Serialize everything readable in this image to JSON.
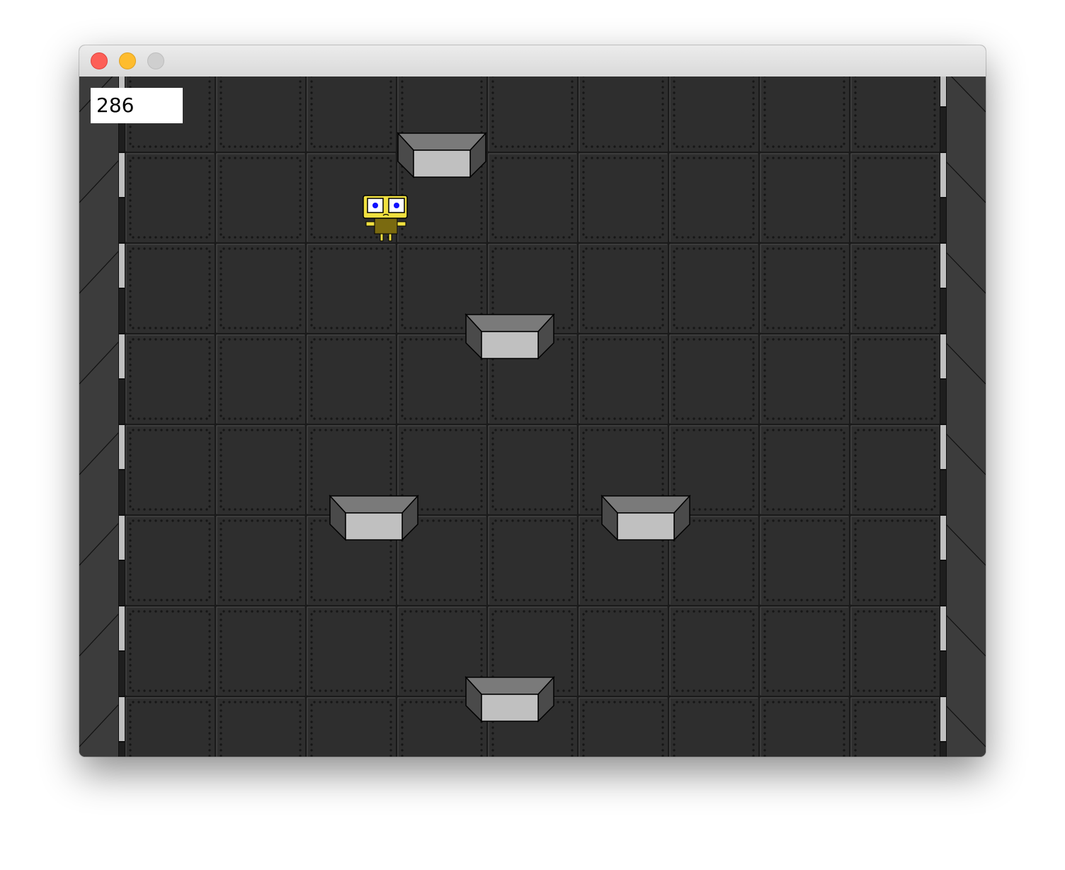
{
  "window": {
    "controls": [
      {
        "name": "close-button",
        "color": "#fd5f57"
      },
      {
        "name": "minimize-button",
        "color": "#febc2e"
      },
      {
        "name": "maximize-button",
        "color": "#cfcfcf"
      }
    ]
  },
  "game": {
    "score": "286",
    "colors": {
      "background": "#2e2e2e",
      "tile_line": "#1a1a1a",
      "tile_highlight": "#4a4a4a",
      "rivet": "#161616",
      "wall": "#3c3c3c",
      "wall_stripe_light": "#c0c0c0",
      "wall_stripe_dark": "#1e1e1e",
      "platform_top": "#7a7a7a",
      "platform_front": "#c0c0c0",
      "platform_side": "#4a4a4a",
      "player_head": "#f0e040",
      "player_body": "#7a6a10",
      "player_eye": "#1010ff"
    },
    "player": {
      "name": "yellow-robot"
    },
    "platforms_count": 5
  }
}
